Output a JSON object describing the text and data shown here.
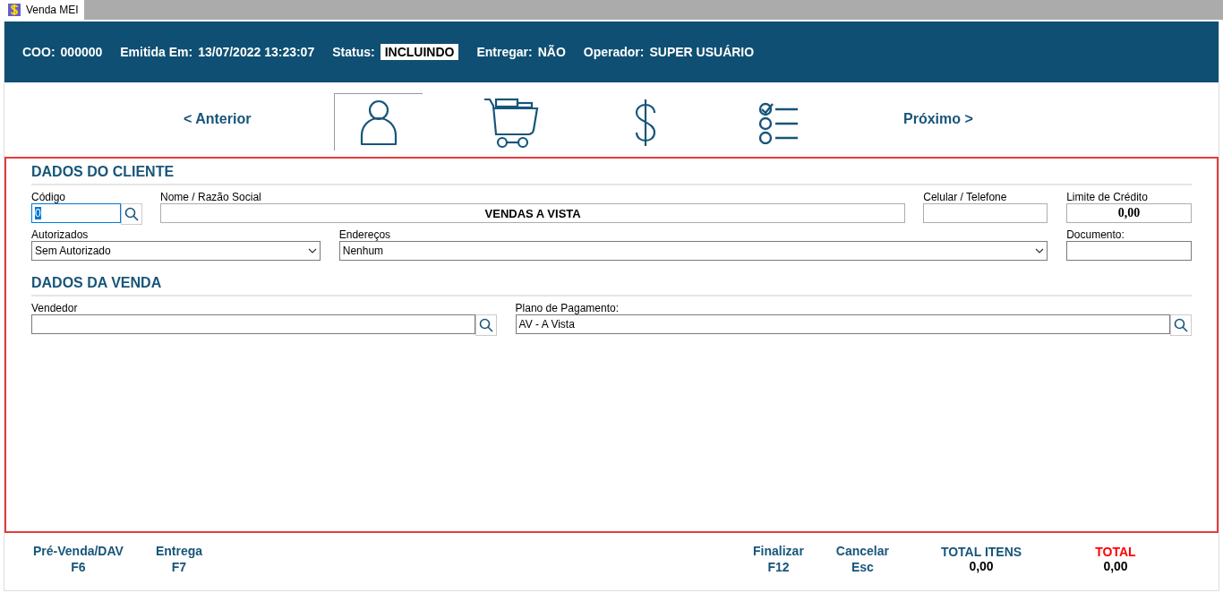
{
  "window": {
    "tab": "Venda MEI"
  },
  "header": [
    {
      "label": "COO:",
      "value": "000000",
      "kind": "plain"
    },
    {
      "label": "Emitida Em:",
      "value": "13/07/2022 13:23:07",
      "kind": "plain"
    },
    {
      "label": "Status:",
      "value": "INCLUINDO",
      "kind": "badge"
    },
    {
      "label": "Entregar:",
      "value": "NÃO",
      "kind": "plain"
    },
    {
      "label": "Operador:",
      "value": "SUPER USUÁRIO",
      "kind": "plain"
    }
  ],
  "nav": {
    "previous": "< Anterior",
    "next": "Próximo >",
    "steps": [
      {
        "kind": "customer",
        "selected": true
      },
      {
        "kind": "cart",
        "selected": false
      },
      {
        "kind": "payment",
        "selected": false
      },
      {
        "kind": "checklist",
        "selected": false
      }
    ]
  },
  "cliente": {
    "title": "DADOS DO CLIENTE",
    "codigo": {
      "label": "Código",
      "value": "0"
    },
    "nome": {
      "label": "Nome / Razão Social",
      "value": "VENDAS A VISTA"
    },
    "celular": {
      "label": "Celular / Telefone"
    },
    "limite": {
      "label": "Limite de Crédito",
      "value": "0,00"
    },
    "autorizados": {
      "label": "Autorizados",
      "value": "Sem Autorizado"
    },
    "enderecos": {
      "label": "Endereços",
      "value": "Nenhum"
    },
    "documento": {
      "label": "Documento:"
    }
  },
  "venda": {
    "title": "DADOS DA VENDA",
    "vendedor": {
      "label": "Vendedor"
    },
    "plano": {
      "label": "Plano de Pagamento:",
      "value": "AV - A Vista"
    }
  },
  "footer": {
    "actions": [
      {
        "label": "Pré-Venda/DAV",
        "key": "F6"
      },
      {
        "label": "Entrega",
        "key": "F7"
      }
    ],
    "actions_right": [
      {
        "label": "Finalizar",
        "key": "F12"
      },
      {
        "label": "Cancelar",
        "key": "Esc"
      }
    ],
    "totals": [
      {
        "label": "TOTAL ITENS",
        "value": "0,00",
        "kind": "items"
      },
      {
        "label": "TOTAL",
        "value": "0,00",
        "kind": "grand"
      }
    ]
  }
}
